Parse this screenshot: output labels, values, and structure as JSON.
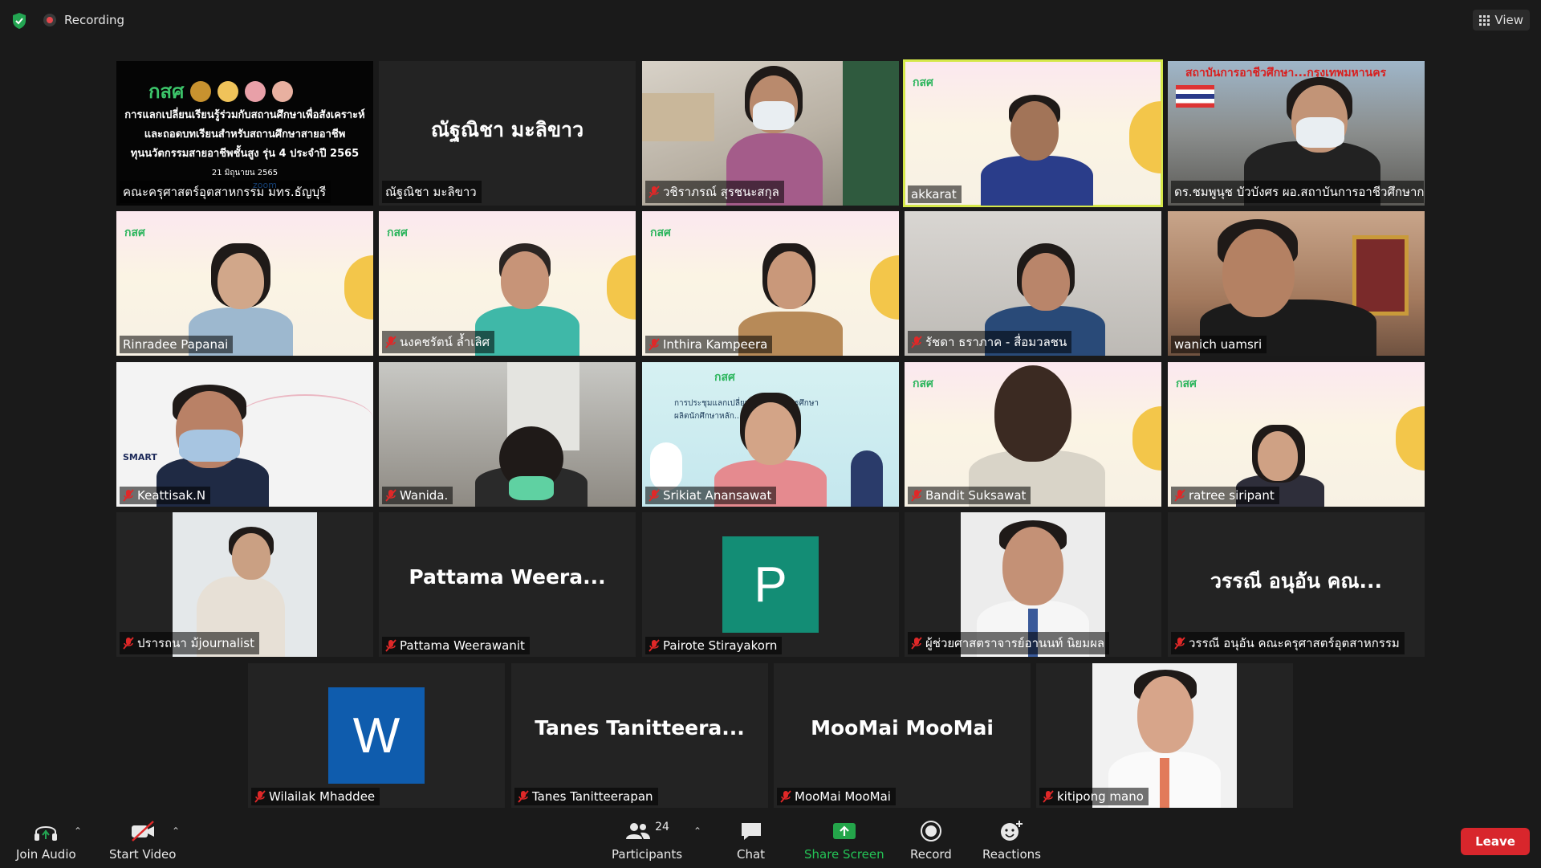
{
  "topbar": {
    "recording_label": "Recording",
    "view_label": "View"
  },
  "tiles": [
    {
      "name": "คณะครุศาสตร์อุตสาหกรรม มทร.ธัญบุรี"
    },
    {
      "name": "ณัฐณิชา มะลิขาว",
      "display": "ณัฐณิชา มะลิขาว"
    },
    {
      "name": "วชิราภรณ์ สุรชนะสกุล"
    },
    {
      "name": "akkarat"
    },
    {
      "name": "ดร.ชมพูนุช บัวบังศร ผอ.สถาบันการอาชีวศึกษากรุง..."
    },
    {
      "name": "Rinradee Papanai"
    },
    {
      "name": "นงคชรัตน์ ล้ำเลิศ"
    },
    {
      "name": "Inthira Kampeera"
    },
    {
      "name": "รัชดา ธราภาค - สื่อมวลชน"
    },
    {
      "name": "wanich uamsri"
    },
    {
      "name": "Keattisak.N"
    },
    {
      "name": "Wanida."
    },
    {
      "name": "Srikiat Anansawat"
    },
    {
      "name": "Bandit Suksawat"
    },
    {
      "name": "ratree siripant"
    },
    {
      "name": "ปรารถนา ม้journalist"
    },
    {
      "name": "Pattama Weerawanit",
      "display": "Pattama  Weera..."
    },
    {
      "name": "Pairote Stirayakorn",
      "letter": "P"
    },
    {
      "name": "ผู้ช่วยศาสตราจารย์อานนท์ นิยมผล"
    },
    {
      "name": "วรรณี อนุอัน คณะครุศาสตร์อุตสาหกรรม",
      "display": "วรรณี  อนุอัน  คณ..."
    },
    {
      "name": "Wilailak Mhaddee",
      "letter": "W"
    },
    {
      "name": "Tanes Tanitteerapan",
      "display": "Tanes  Tanitteera..."
    },
    {
      "name": "MooMai MooMai",
      "display": "MooMai MooMai"
    },
    {
      "name": "kitipong mano"
    }
  ],
  "banner": {
    "org": "กสศ",
    "line1": "การแลกเปลี่ยนเรียนรู้ร่วมกับสถานศึกษาเพื่อสังเคราะห์",
    "line2": "และถอดบทเรียนสำหรับสถานศึกษาสายอาชีพ",
    "line3": "ทุนนวัตกรรมสายอาชีพชั้นสูง รุ่น 4 ประจำปี 2565",
    "date": "21 มิถุนายน 2565",
    "zoom": "zoom"
  },
  "institute_sign": "สถาบันการอาชีวศึกษา...กรุงเทพมหานคร",
  "slide_poster": {
    "org": "กสศ",
    "line1": "การประชุมแลกเปลี่ยน... สถาบันการศึกษา",
    "line2": "ผลิตนักศึกษาหลัก... การศึกษา 2564"
  },
  "toolbar": {
    "join_audio": "Join Audio",
    "start_video": "Start Video",
    "participants": "Participants",
    "participants_count": "24",
    "chat": "Chat",
    "share_screen": "Share Screen",
    "record": "Record",
    "reactions": "Reactions",
    "leave": "Leave"
  },
  "colors": {
    "background": "#1a1a1a",
    "tile": "#232323",
    "active_speaker": "#d5e84a",
    "share_green": "#24a54a",
    "leave_red": "#d8262c",
    "avatar_teal": "#138d75",
    "avatar_blue": "#0f5cad",
    "mute_red": "#e02828"
  },
  "icons": [
    "shield-icon",
    "recording-icon",
    "grid-view-icon",
    "headphone-icon",
    "video-off-icon",
    "participants-icon",
    "chat-icon",
    "share-screen-icon",
    "record-icon",
    "reactions-icon",
    "mic-muted-icon"
  ]
}
